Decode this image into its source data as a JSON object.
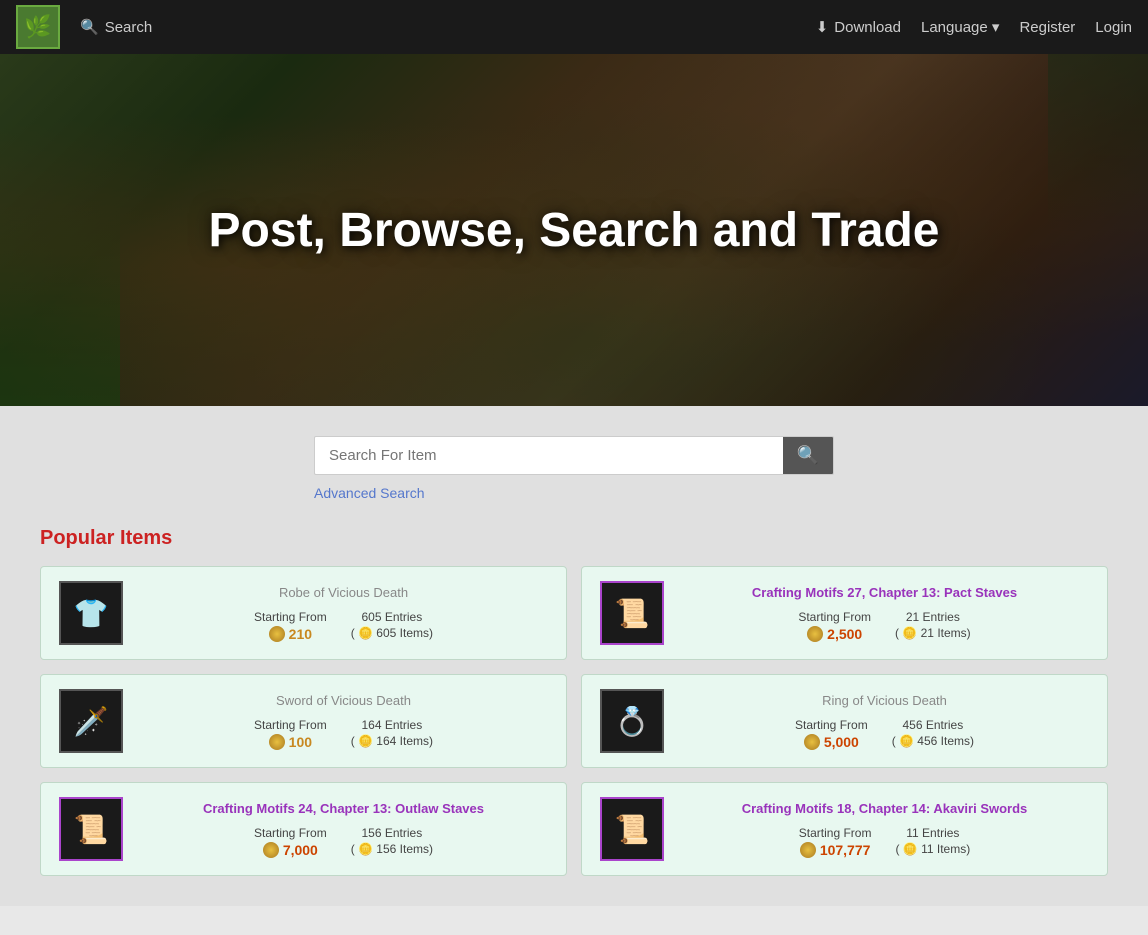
{
  "navbar": {
    "logo_icon": "🌿",
    "search_label": "Search",
    "download_label": "Download",
    "language_label": "Language",
    "language_arrow": "▾",
    "register_label": "Register",
    "login_label": "Login"
  },
  "hero": {
    "title": "Post, Browse, Search and Trade"
  },
  "search": {
    "placeholder": "Search For Item",
    "advanced_label": "Advanced Search"
  },
  "popular": {
    "section_title": "Popular Items",
    "items": [
      {
        "id": "robe-vicious-death",
        "name": "Robe of Vicious Death",
        "name_style": "gray",
        "icon": "👕",
        "starting_from_label": "Starting From",
        "price": "210",
        "entries_label": "605 Entries",
        "items_label": "( 🪙 605 Items)",
        "price_color": "gold"
      },
      {
        "id": "crafting-motifs-27",
        "name": "Crafting Motifs 27, Chapter 13: Pact Staves",
        "name_style": "purple",
        "icon": "📜",
        "starting_from_label": "Starting From",
        "price": "2,500",
        "entries_label": "21 Entries",
        "items_label": "( 🪙 21 Items)",
        "price_color": "red"
      },
      {
        "id": "sword-vicious-death",
        "name": "Sword of Vicious Death",
        "name_style": "gray",
        "icon": "🗡️",
        "starting_from_label": "Starting From",
        "price": "100",
        "entries_label": "164 Entries",
        "items_label": "( 🪙 164 Items)",
        "price_color": "gold"
      },
      {
        "id": "ring-vicious-death",
        "name": "Ring of Vicious Death",
        "name_style": "gray",
        "icon": "💍",
        "starting_from_label": "Starting From",
        "price": "5,000",
        "entries_label": "456 Entries",
        "items_label": "( 🪙 456 Items)",
        "price_color": "red"
      },
      {
        "id": "crafting-motifs-24",
        "name": "Crafting Motifs 24, Chapter 13: Outlaw Staves",
        "name_style": "purple",
        "icon": "📜",
        "starting_from_label": "Starting From",
        "price": "7,000",
        "entries_label": "156 Entries",
        "items_label": "( 🪙 156 Items)",
        "price_color": "red"
      },
      {
        "id": "crafting-motifs-18",
        "name": "Crafting Motifs 18, Chapter 14: Akaviri Swords",
        "name_style": "purple",
        "icon": "📜",
        "starting_from_label": "Starting From",
        "price": "107,777",
        "entries_label": "11 Entries",
        "items_label": "( 🪙 11 Items)",
        "price_color": "red"
      }
    ]
  }
}
